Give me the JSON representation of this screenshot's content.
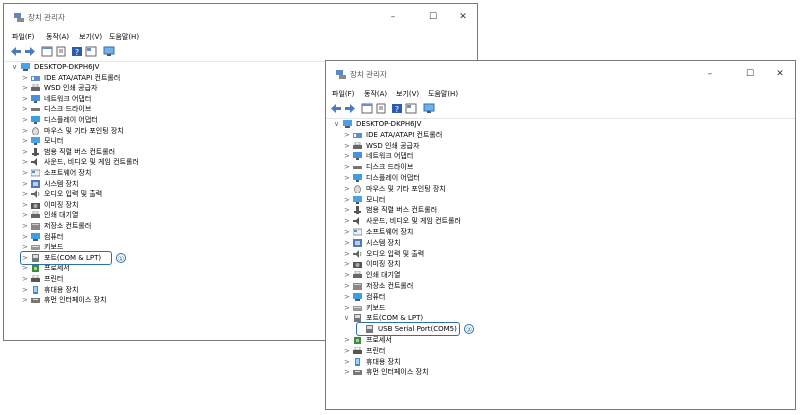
{
  "window1": {
    "title": "장치 관리자",
    "menu": [
      "파일(F)",
      "동작(A)",
      "보기(V)",
      "도움말(H)"
    ],
    "root": "DESKTOP-DKPH6JV",
    "items": [
      "IDE ATA/ATAPI 컨트롤러",
      "WSD 인쇄 공급자",
      "네트워크 어댑터",
      "디스크 드라이브",
      "디스플레이 어댑터",
      "마우스 및 기타 포인팅 장치",
      "모니터",
      "범용 직렬 버스 컨트롤러",
      "사운드, 비디오 및 게임 컨트롤러",
      "소프트웨어 장치",
      "시스템 장치",
      "오디오 입력 및 출력",
      "이미징 장치",
      "인쇄 대기열",
      "저장소 컨트롤러",
      "컴퓨터",
      "키보드",
      "포트(COM & LPT)",
      "프로세서",
      "프린터",
      "휴대용 장치",
      "휴먼 인터페이스 장치"
    ],
    "marker": "①"
  },
  "window2": {
    "title": "장치 관리자",
    "menu": [
      "파일(F)",
      "동작(A)",
      "보기(V)",
      "도움말(H)"
    ],
    "root": "DESKTOP-DKPH6JV",
    "items": [
      "IDE ATA/ATAPI 컨트롤러",
      "WSD 인쇄 공급자",
      "네트워크 어댑터",
      "디스크 드라이브",
      "디스플레이 어댑터",
      "마우스 및 기타 포인팅 장치",
      "모니터",
      "범용 직렬 버스 컨트롤러",
      "사운드, 비디오 및 게임 컨트롤러",
      "소프트웨어 장치",
      "시스템 장치",
      "오디오 입력 및 출력",
      "이미징 장치",
      "인쇄 대기열",
      "저장소 컨트롤러",
      "컴퓨터",
      "키보드",
      "포트(COM & LPT)"
    ],
    "child": "USB Serial Port(COM5)",
    "items_after": [
      "프로세서",
      "프린터",
      "휴대용 장치",
      "휴먼 인터페이스 장치"
    ],
    "marker": "②"
  },
  "icons": {
    "title": "device-manager-icon",
    "toolbar": [
      "back-icon",
      "forward-icon",
      "properties-icon",
      "update-driver-icon",
      "help-icon",
      "view-icon",
      "monitor-icon"
    ],
    "minimize": "–",
    "maximize": "☐",
    "close": "✕"
  },
  "colors": {
    "highlight": "#2e6fae"
  }
}
